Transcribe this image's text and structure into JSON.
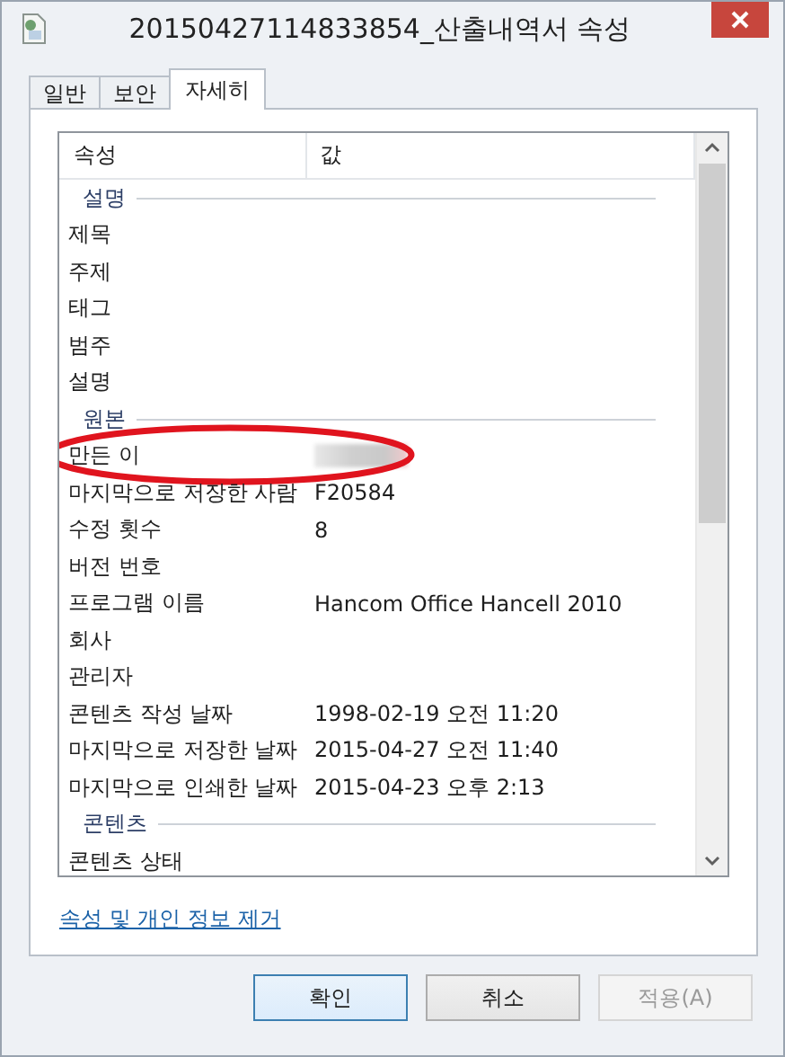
{
  "window": {
    "title": "20150427114833854_산출내역서 속성"
  },
  "tabs": [
    {
      "label": "일반",
      "selected": false
    },
    {
      "label": "보안",
      "selected": false
    },
    {
      "label": "자세히",
      "selected": true
    }
  ],
  "list": {
    "columns": [
      "속성",
      "값"
    ],
    "rows": [
      {
        "kind": "group",
        "label": "설명"
      },
      {
        "kind": "item",
        "name": "제목"
      },
      {
        "kind": "item",
        "name": "주제"
      },
      {
        "kind": "item",
        "name": "태그"
      },
      {
        "kind": "item",
        "name": "범주"
      },
      {
        "kind": "item",
        "name": "설명"
      },
      {
        "kind": "group",
        "label": "원본"
      },
      {
        "kind": "item",
        "name": "만든 이",
        "redacted": true,
        "circled": true
      },
      {
        "kind": "item",
        "name": "마지막으로 저장한 사람",
        "value": "F20584"
      },
      {
        "kind": "item",
        "name": "수정 횟수",
        "value": "8"
      },
      {
        "kind": "item",
        "name": "버전 번호"
      },
      {
        "kind": "item",
        "name": "프로그램 이름",
        "value": "Hancom Office Hancell 2010"
      },
      {
        "kind": "item",
        "name": "회사"
      },
      {
        "kind": "item",
        "name": "관리자"
      },
      {
        "kind": "item",
        "name": "콘텐츠 작성 날짜",
        "value": "1998-02-19 오전 11:20"
      },
      {
        "kind": "item",
        "name": "마지막으로 저장한 날짜",
        "value": "2015-04-27 오전 11:40"
      },
      {
        "kind": "item",
        "name": "마지막으로 인쇄한 날짜",
        "value": "2015-04-23 오후 2:13"
      },
      {
        "kind": "group",
        "label": "콘텐츠"
      },
      {
        "kind": "item",
        "name": "콘텐츠 상태"
      }
    ]
  },
  "link": "속성 및 개인 정보 제거",
  "buttons": [
    {
      "label": "확인",
      "default": true,
      "disabled": false
    },
    {
      "label": "취소",
      "default": false,
      "disabled": false
    },
    {
      "label": "적용(A)",
      "default": false,
      "disabled": true
    }
  ]
}
